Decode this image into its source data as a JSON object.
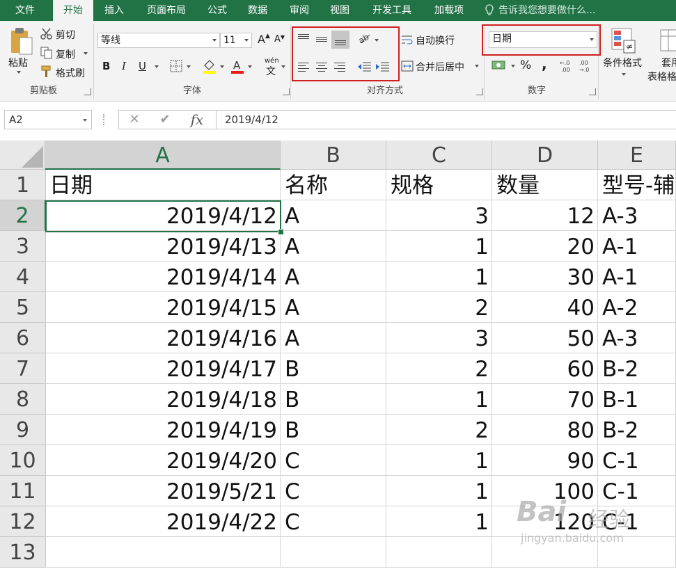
{
  "menu": {
    "tabs": [
      "文件",
      "开始",
      "插入",
      "页面布局",
      "公式",
      "数据",
      "审阅",
      "视图",
      "开发工具",
      "加载项"
    ],
    "active": "开始",
    "tell_me": "告诉我您想要做什么..."
  },
  "ribbon": {
    "clipboard": {
      "paste": "粘贴",
      "cut": "剪切",
      "copy": "复制",
      "format_painter": "格式刷",
      "label": "剪贴板"
    },
    "font": {
      "font_name": "等线",
      "font_size": "11",
      "label": "字体",
      "bold": "B",
      "italic": "I",
      "underline": "U",
      "wen": "wén",
      "wen_char": "文"
    },
    "alignment": {
      "wrap_text": "自动换行",
      "merge_center": "合并后居中",
      "label": "对齐方式"
    },
    "number": {
      "format": "日期",
      "label": "数字",
      "percent": "%",
      "comma": ","
    },
    "styles": {
      "conditional": "条件格式",
      "table_format_a": "套用",
      "table_format_b": "表格格"
    }
  },
  "formula_bar": {
    "name_box": "A2",
    "cancel": "✕",
    "enter": "✔",
    "fx": "fx",
    "content": "2019/4/12"
  },
  "columns": [
    "A",
    "B",
    "C",
    "D",
    "E"
  ],
  "selected_column": "A",
  "selected_row": "2",
  "row_numbers": [
    "1",
    "2",
    "3",
    "4",
    "5",
    "6",
    "7",
    "8",
    "9",
    "10",
    "11",
    "12",
    "13"
  ],
  "header_row": [
    "日期",
    "名称",
    "规格",
    "数量",
    "型号-辅"
  ],
  "rows": [
    [
      "2019/4/12",
      "A",
      "3",
      "12",
      "A-3"
    ],
    [
      "2019/4/13",
      "A",
      "1",
      "20",
      "A-1"
    ],
    [
      "2019/4/14",
      "A",
      "1",
      "30",
      "A-1"
    ],
    [
      "2019/4/15",
      "A",
      "2",
      "40",
      "A-2"
    ],
    [
      "2019/4/16",
      "A",
      "3",
      "50",
      "A-3"
    ],
    [
      "2019/4/17",
      "B",
      "2",
      "60",
      "B-2"
    ],
    [
      "2019/4/18",
      "B",
      "1",
      "70",
      "B-1"
    ],
    [
      "2019/4/19",
      "B",
      "2",
      "80",
      "B-2"
    ],
    [
      "2019/4/20",
      "C",
      "1",
      "90",
      "C-1"
    ],
    [
      "2019/5/21",
      "C",
      "1",
      "100",
      "C-1"
    ],
    [
      "2019/4/22",
      "C",
      "1",
      "120",
      "C-1"
    ]
  ],
  "watermark": {
    "brand": "Bai",
    "brand_cn": "经验",
    "url": "jingyan.baidu.com"
  },
  "colors": {
    "accent": "#217346",
    "highlight_box": "#d02020",
    "ribbon_bg": "#f3f3f3"
  }
}
